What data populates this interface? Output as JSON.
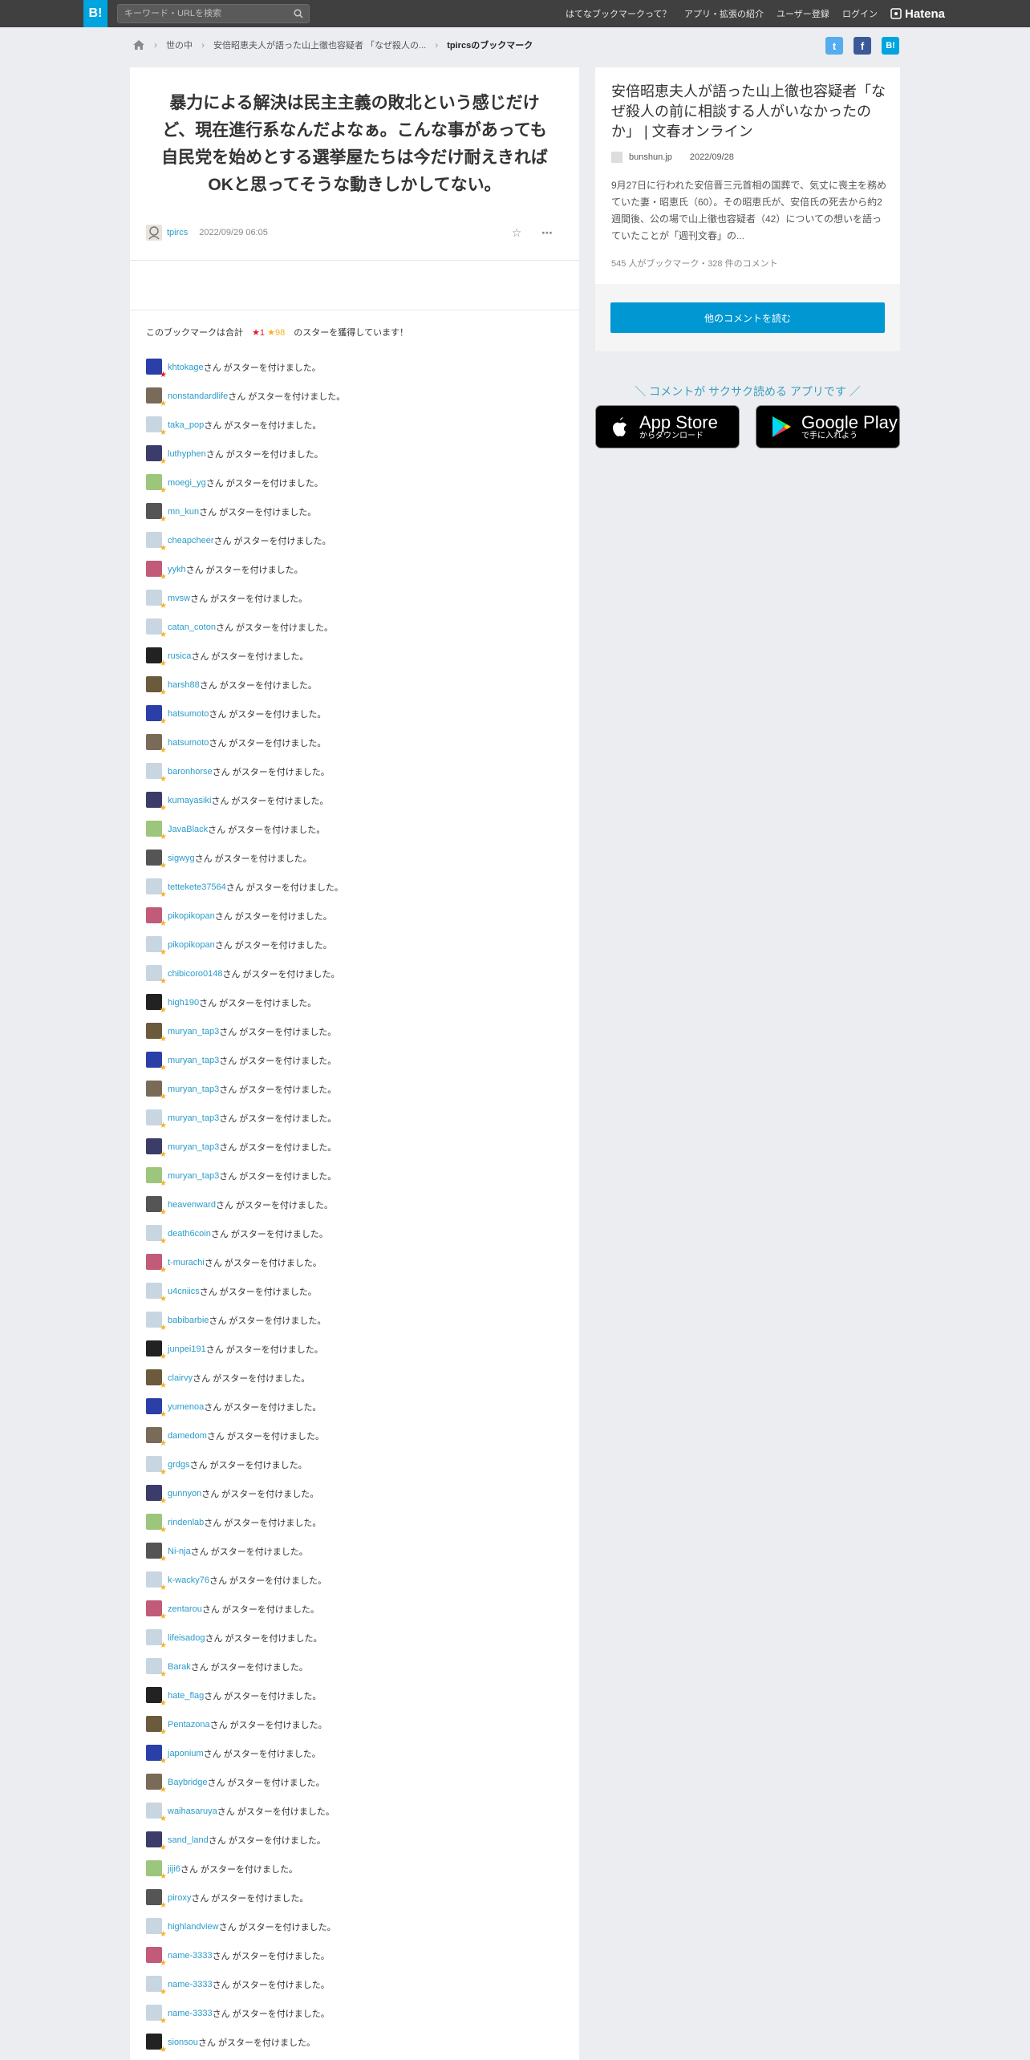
{
  "header": {
    "logo": "B!",
    "search_placeholder": "キーワード・URLを検索",
    "nav": [
      "はてなブックマークって？",
      "アプリ・拡張の紹介",
      "ユーザー登録",
      "ログイン"
    ],
    "brand": "Hatena"
  },
  "breadcrumb": {
    "items": [
      "世の中",
      "安倍昭恵夫人が語った山上徹也容疑者 「なぜ殺人の...",
      "tpircsのブックマーク"
    ]
  },
  "bookmark": {
    "text": "暴力による解決は民主主義の敗北という感じだけど、現在進行系なんだよなぁ。こんな事があっても自民党を始めとする選挙屋たちは今だけ耐えきればOKと思ってそうな動きしかしてない。",
    "user": "tpircs",
    "date": "2022/09/29 06:05"
  },
  "stars": {
    "prefix": "このブックマークは合計",
    "red": "★1",
    "yellow": "★98",
    "suffix": "のスターを獲得しています！",
    "suffix_text": "さん がスターを付けました。",
    "users": [
      "khtokage",
      "nonstandardlife",
      "taka_pop",
      "luthyphen",
      "moegi_yg",
      "mn_kun",
      "cheapcheer",
      "yykh",
      "mvsw",
      "catan_coton",
      "rusica",
      "harsh88",
      "hatsumoto",
      "hatsumoto",
      "baronhorse",
      "kumayasiki",
      "JavaBlack",
      "sigwyg",
      "tettekete37564",
      "pikopikopan",
      "pikopikopan",
      "chibicoro0148",
      "high190",
      "muryan_tap3",
      "muryan_tap3",
      "muryan_tap3",
      "muryan_tap3",
      "muryan_tap3",
      "muryan_tap3",
      "heavenward",
      "death6coin",
      "t-murachi",
      "u4cniics",
      "babibarbie",
      "junpei191",
      "clairvy",
      "yumenoa",
      "damedom",
      "grdgs",
      "gunnyon",
      "rindenlab",
      "Ni-nja",
      "k-wacky76",
      "zentarou",
      "lifeisadog",
      "Barak",
      "hate_flag",
      "Pentazona",
      "japonium",
      "Baybridge",
      "waihasaruya",
      "sand_land",
      "jiji6",
      "piroxy",
      "highlandview",
      "name-3333",
      "name-3333",
      "name-3333",
      "sionsou"
    ]
  },
  "entry": {
    "title": "安倍昭恵夫人が語った山上徹也容疑者「なぜ殺人の前に相談する人がいなかったのか」 | 文春オンライン",
    "domain": "bunshun.jp",
    "date": "2022/09/28",
    "description": "9月27日に行われた安倍晋三元首相の国葬で、気丈に喪主を務めていた妻・昭恵氏（60）。その昭恵氏が、安倍氏の死去から約2週間後、公の場で山上徹也容疑者（42）についての想いを語っていたことが「週刊文春」の...",
    "count": "545 人がブックマーク・328 件のコメント",
    "more_button": "他のコメントを読む"
  },
  "promo": {
    "text": "＼ コメントが サクサク読める アプリです ／",
    "appstore_small": "からダウンロード",
    "appstore_big": "App Store",
    "googleplay_big": "Google Play",
    "googleplay_small": "で手に入れよう"
  },
  "colors": {
    "accent": "#00a4de",
    "link": "#2a9bc9",
    "red_star": "#e0182f",
    "yellow_star": "#f4b128"
  }
}
